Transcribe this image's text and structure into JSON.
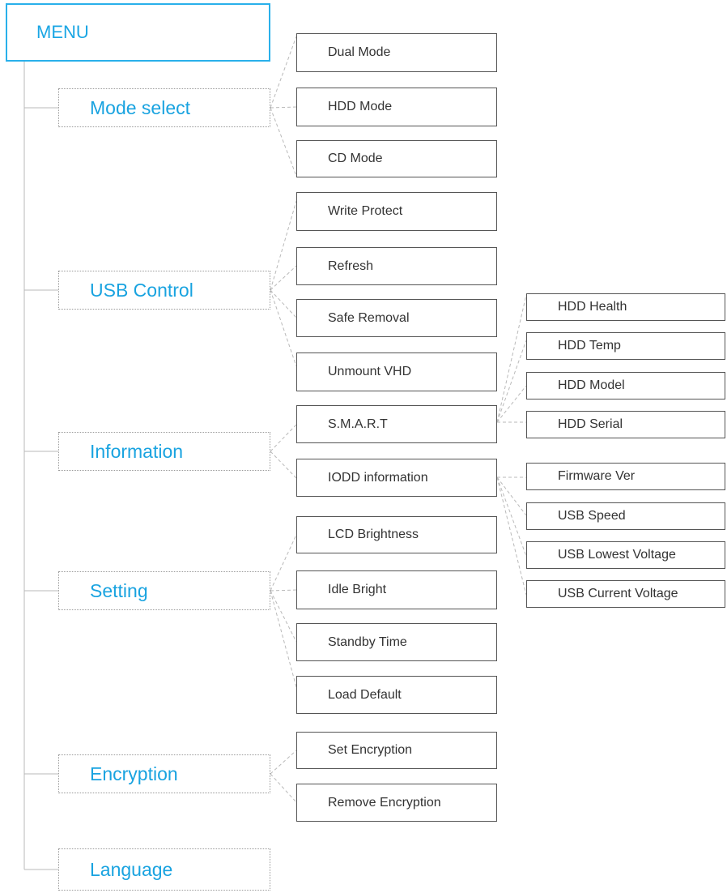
{
  "root": {
    "label": "MENU"
  },
  "categories": [
    {
      "id": "mode",
      "label": "Mode select"
    },
    {
      "id": "usb",
      "label": "USB Control"
    },
    {
      "id": "info",
      "label": "Information"
    },
    {
      "id": "setting",
      "label": "Setting"
    },
    {
      "id": "enc",
      "label": "Encryption"
    },
    {
      "id": "lang",
      "label": "Language"
    }
  ],
  "mode_items": [
    "Dual Mode",
    "HDD Mode",
    "CD Mode"
  ],
  "usb_items": [
    "Write Protect",
    "Refresh",
    "Safe Removal",
    "Unmount VHD"
  ],
  "info_items": [
    "S.M.A.R.T",
    "IODD information"
  ],
  "setting_items": [
    "LCD Brightness",
    "Idle Bright",
    "Standby Time",
    "Load Default"
  ],
  "encryption_items": [
    "Set Encryption",
    "Remove Encryption"
  ],
  "smart_items": [
    "HDD Health",
    "HDD Temp",
    "HDD Model",
    "HDD Serial"
  ],
  "iodd_info_items": [
    "Firmware Ver",
    "USB Speed",
    "USB Lowest Voltage",
    "USB Current Voltage"
  ],
  "colors": {
    "accent": "#1aa6e4",
    "box_border": "#555555",
    "line": "#b9b9b9",
    "text": "#333333"
  }
}
